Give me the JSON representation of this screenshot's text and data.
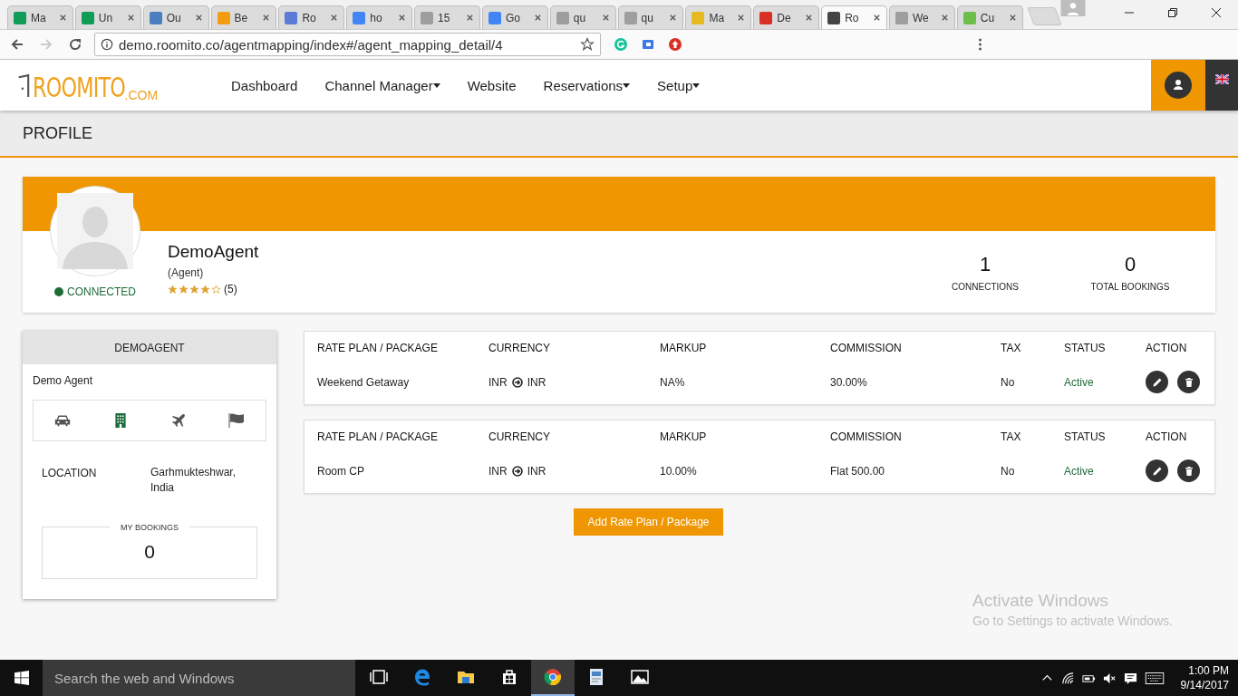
{
  "browser": {
    "tabs": [
      {
        "title": "Ma",
        "color": "#0f9d58",
        "selected": false
      },
      {
        "title": "Un",
        "color": "#0f9d58",
        "selected": false
      },
      {
        "title": "Ou",
        "color": "#4a7fc1",
        "selected": false
      },
      {
        "title": "Be",
        "color": "#f39c12",
        "selected": false
      },
      {
        "title": "Ro",
        "color": "#5a7bd6",
        "selected": false
      },
      {
        "title": "ho",
        "color": "#4285f4",
        "selected": false
      },
      {
        "title": "15",
        "color": "#9e9e9e",
        "selected": false
      },
      {
        "title": "Go",
        "color": "#4285f4",
        "selected": false
      },
      {
        "title": "qu",
        "color": "#9e9e9e",
        "selected": false
      },
      {
        "title": "qu",
        "color": "#9e9e9e",
        "selected": false
      },
      {
        "title": "Ma",
        "color": "#e5b91f",
        "selected": false
      },
      {
        "title": "De",
        "color": "#d93025",
        "selected": false
      },
      {
        "title": "Ro",
        "color": "#444444",
        "selected": true
      },
      {
        "title": "We",
        "color": "#9e9e9e",
        "selected": false
      },
      {
        "title": "Cu",
        "color": "#6cbf4a",
        "selected": false
      }
    ],
    "url": "demo.roomito.co/agentmapping/index#/agent_mapping_detail/4"
  },
  "app": {
    "logo": {
      "name": "ROOMITO",
      "suffix": ".COM"
    },
    "nav": [
      {
        "label": "Dashboard",
        "dropdown": false
      },
      {
        "label": "Channel Manager",
        "dropdown": true
      },
      {
        "label": "Website",
        "dropdown": false
      },
      {
        "label": "Reservations",
        "dropdown": true
      },
      {
        "label": "Setup",
        "dropdown": true
      }
    ],
    "page_title": "PROFILE"
  },
  "profile": {
    "name": "DemoAgent",
    "role": "(Agent)",
    "status": "CONNECTED",
    "stars": 4,
    "rating_count": "(5)",
    "stats": [
      {
        "value": "1",
        "label": "CONNECTIONS"
      },
      {
        "value": "0",
        "label": "TOTAL BOOKINGS"
      }
    ]
  },
  "agent_panel": {
    "header": "DEMOAGENT",
    "name": "Demo Agent",
    "services": [
      {
        "kind": "car"
      },
      {
        "kind": "hotel"
      },
      {
        "kind": "flight"
      },
      {
        "kind": "tour"
      }
    ],
    "location_label": "LOCATION",
    "location_value": "Garhmukteshwar, India",
    "bookings_label": "MY BOOKINGS",
    "bookings_value": "0"
  },
  "rate_plans": [
    {
      "columns": [
        "RATE PLAN / PACKAGE",
        "CURRENCY",
        "MARKUP",
        "COMMISSION",
        "TAX",
        "STATUS",
        "ACTION"
      ],
      "name": "Weekend Getaway",
      "currency_from": "INR",
      "currency_to": "INR",
      "markup": "NA%",
      "commission": "30.00%",
      "tax": "No",
      "status": "Active"
    },
    {
      "columns": [
        "RATE PLAN / PACKAGE",
        "CURRENCY",
        "MARKUP",
        "COMMISSION",
        "TAX",
        "STATUS",
        "ACTION"
      ],
      "name": "Room CP",
      "currency_from": "INR",
      "currency_to": "INR",
      "markup": "10.00%",
      "commission": "Flat 500.00",
      "tax": "No",
      "status": "Active"
    }
  ],
  "add_button": "Add Rate Plan / Package",
  "activation": {
    "title": "Activate Windows",
    "subtitle": "Go to Settings to activate Windows."
  },
  "taskbar": {
    "search_placeholder": "Search the web and Windows",
    "apps": [
      {
        "kind": "task-view",
        "selected": false
      },
      {
        "kind": "edge",
        "selected": false
      },
      {
        "kind": "explorer",
        "selected": false
      },
      {
        "kind": "store",
        "selected": false
      },
      {
        "kind": "chrome",
        "selected": true
      },
      {
        "kind": "document",
        "selected": false
      },
      {
        "kind": "photos",
        "selected": false
      }
    ],
    "time": "1:00 PM",
    "date": "9/14/2017"
  }
}
